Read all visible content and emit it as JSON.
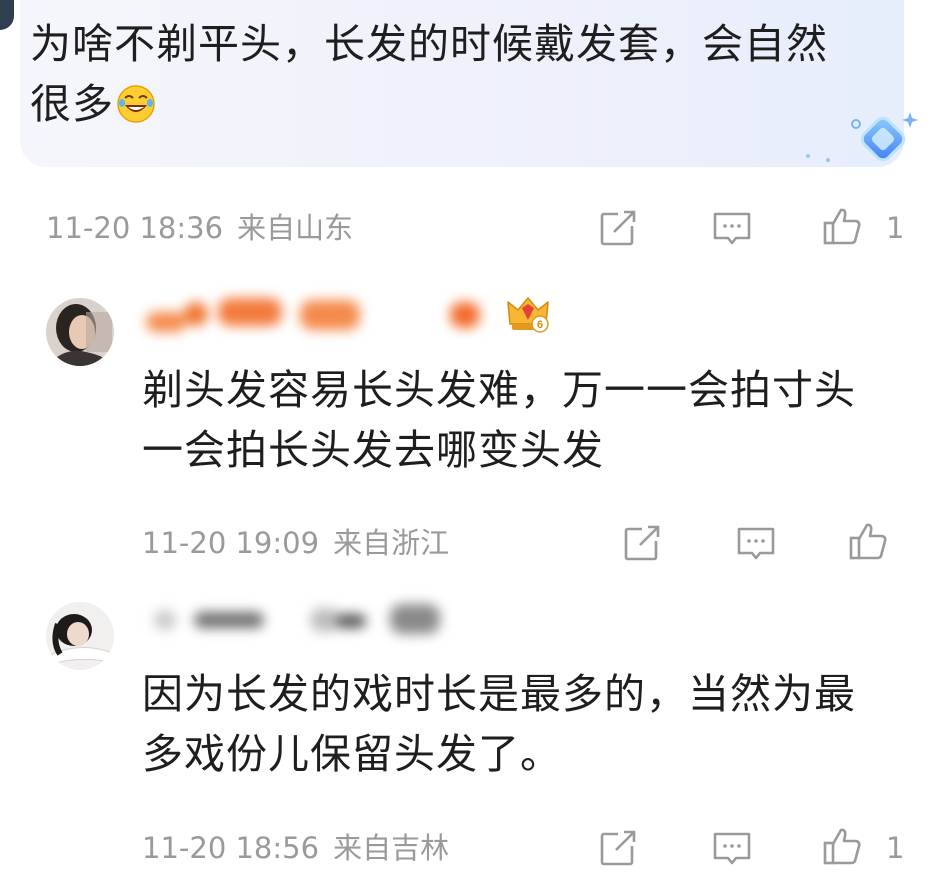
{
  "comment": {
    "text": "为啥不剃平头，长发的时候戴发套，会自然很多",
    "emoji_icon": "laughing-tears-emoji",
    "time": "11-20 18:36",
    "location": "来自山东",
    "like_count": "1"
  },
  "replies": [
    {
      "text": "剃头发容易长头发难，万一一会拍寸头一会拍长头发去哪变头发",
      "time": "11-20 19:09",
      "location": "来自浙江",
      "like_count": "",
      "level_badge": "6"
    },
    {
      "text": "因为长发的戏时长是最多的，当然为最多戏份儿保留头发了。",
      "time": "11-20 18:56",
      "location": "来自吉林",
      "like_count": "1"
    }
  ],
  "icons": {
    "share": "share-icon",
    "reply": "reply-icon",
    "like": "thumbs-up-icon",
    "crown": "crown-badge-icon"
  },
  "colors": {
    "meta_gray": "#9a9a9a",
    "text": "#1e1e1e",
    "bubble_bg": "#eef1fb",
    "name_blur": "#f47a3c"
  }
}
